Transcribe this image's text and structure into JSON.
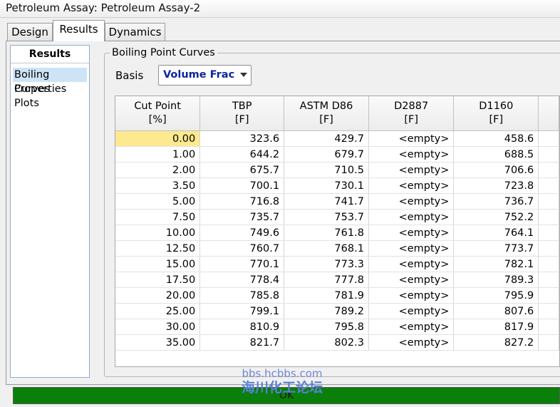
{
  "window": {
    "title": "Petroleum Assay: Petroleum Assay-2"
  },
  "tabs": [
    {
      "label": "Design",
      "active": false
    },
    {
      "label": "Results",
      "active": true
    },
    {
      "label": "Dynamics",
      "active": false
    }
  ],
  "nav": {
    "header": "Results",
    "items": [
      {
        "label": "Boiling Curves",
        "selected": true
      },
      {
        "label": "Properties",
        "selected": false
      },
      {
        "label": "Plots",
        "selected": false
      }
    ]
  },
  "group": {
    "title": "Boiling Point Curves"
  },
  "basis": {
    "label": "Basis",
    "value": "Volume Frac"
  },
  "table": {
    "columns": [
      {
        "name": "Cut Point",
        "unit": "[%]"
      },
      {
        "name": "TBP",
        "unit": "[F]"
      },
      {
        "name": "ASTM D86",
        "unit": "[F]"
      },
      {
        "name": "D2887",
        "unit": "[F]"
      },
      {
        "name": "D1160",
        "unit": "[F]"
      }
    ],
    "rows": [
      [
        "0.00",
        "323.6",
        "429.7",
        "<empty>",
        "458.6"
      ],
      [
        "1.00",
        "644.2",
        "679.7",
        "<empty>",
        "688.5"
      ],
      [
        "2.00",
        "675.7",
        "710.5",
        "<empty>",
        "706.6"
      ],
      [
        "3.50",
        "700.1",
        "730.1",
        "<empty>",
        "723.8"
      ],
      [
        "5.00",
        "716.8",
        "741.7",
        "<empty>",
        "736.7"
      ],
      [
        "7.50",
        "735.7",
        "753.7",
        "<empty>",
        "752.2"
      ],
      [
        "10.00",
        "749.6",
        "761.8",
        "<empty>",
        "764.1"
      ],
      [
        "12.50",
        "760.7",
        "768.1",
        "<empty>",
        "773.7"
      ],
      [
        "15.00",
        "770.1",
        "773.3",
        "<empty>",
        "782.1"
      ],
      [
        "17.50",
        "778.4",
        "777.8",
        "<empty>",
        "789.3"
      ],
      [
        "20.00",
        "785.8",
        "781.9",
        "<empty>",
        "795.9"
      ],
      [
        "25.00",
        "799.1",
        "789.2",
        "<empty>",
        "807.6"
      ],
      [
        "30.00",
        "810.9",
        "795.8",
        "<empty>",
        "817.9"
      ],
      [
        "35.00",
        "821.7",
        "802.3",
        "<empty>",
        "827.2"
      ]
    ]
  },
  "status": {
    "text": "OK",
    "color": "#0a7f0a"
  },
  "watermark": {
    "line1": "bbs.hcbbs.com",
    "line2": "海川化工论坛"
  }
}
